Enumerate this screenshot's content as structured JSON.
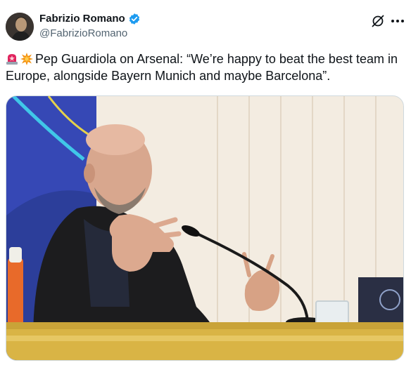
{
  "author": {
    "display_name": "Fabrizio Romano",
    "handle": "@FabrizioRomano",
    "verified": true
  },
  "icons": {
    "verified": "verified-badge-icon",
    "grok": "grok-icon",
    "more": "more-icon"
  },
  "tweet": {
    "emojis": [
      "rotating-light-emoji",
      "collision-emoji"
    ],
    "text": "Pep Guardiola on Arsenal: “We’re happy to beat the best team in Europe, alongside Bayern Munich and maybe Barcelona”."
  },
  "media": {
    "type": "photo"
  },
  "colors": {
    "verified_blue": "#1d9bf0",
    "text": "#0f1419",
    "secondary": "#536471"
  }
}
